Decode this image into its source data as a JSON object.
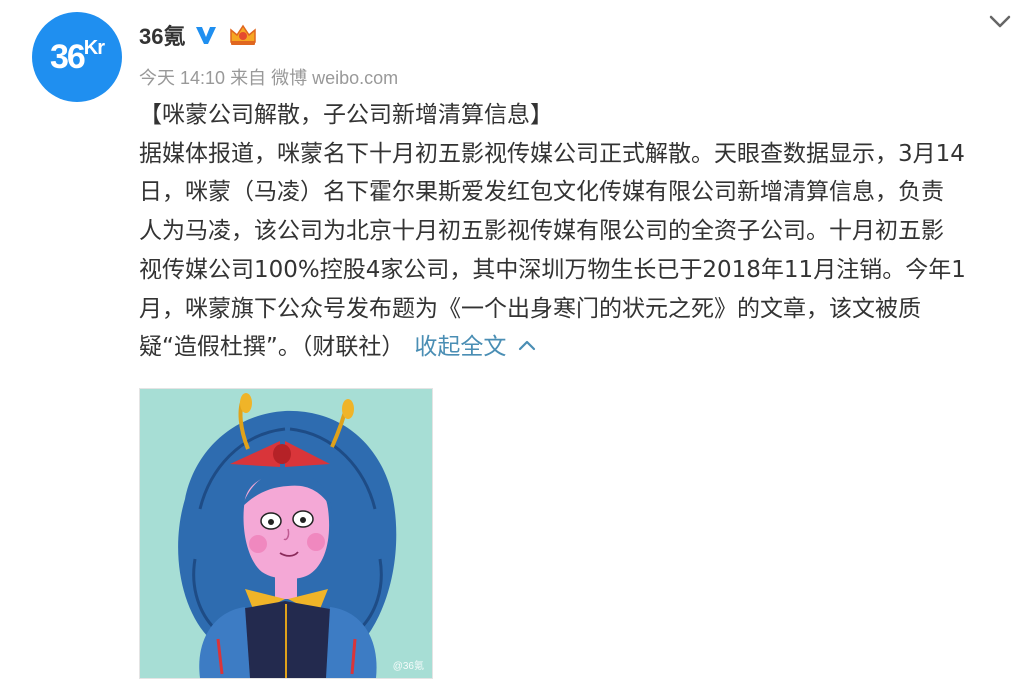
{
  "account": {
    "avatar_text": "36",
    "avatar_sup": "Kr",
    "name": "36氪"
  },
  "icons": {
    "verified": "verified-v-icon",
    "vip": "vip-crown-icon",
    "more": "chevron-down-icon",
    "collapse": "chevron-up-icon"
  },
  "meta": {
    "time": "今天 14:10",
    "source": "来自 微博 weibo.com"
  },
  "post": {
    "lines": [
      "【咪蒙公司解散，子公司新增清算信息】",
      "据媒体报道，咪蒙名下十月初五影视传媒公司正式解散。天眼查数据显示，3月14",
      "日，咪蒙（马凌）名下霍尔果斯爱发红包文化传媒有限公司新增清算信息，负责",
      "人为马凌，该公司为北京十月初五影视传媒有限公司的全资子公司。十月初五影",
      "视传媒公司100%控股4家公司，其中深圳万物生长已于2018年11月注销。今年1",
      "月，咪蒙旗下公众号发布题为《一个出身寒门的状元之死》的文章，该文被质"
    ],
    "last_line": "疑“造假杜撰”。（财联社）",
    "collapse_label": "收起全文"
  },
  "image": {
    "watermark": "@36氪"
  },
  "colors": {
    "avatar_bg": "#1f8ff0",
    "verified": "#1f8ff0",
    "link": "#4a8eb4",
    "meta": "#999999",
    "text": "#333333",
    "image_bg": "#a7ded5"
  }
}
